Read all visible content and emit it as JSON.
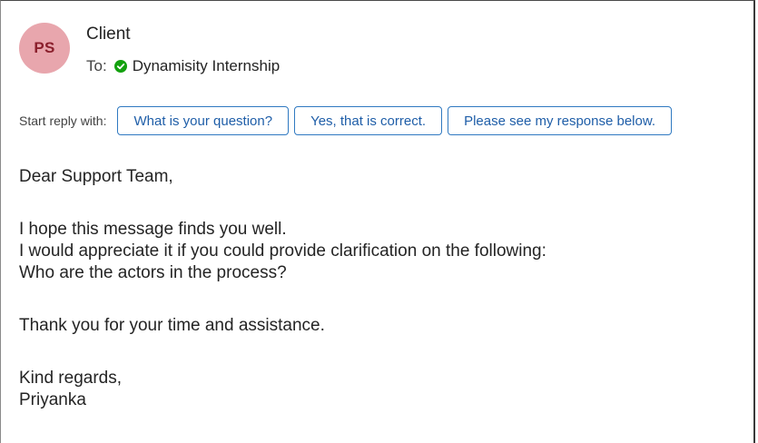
{
  "header": {
    "avatar_initials": "PS",
    "avatar_color": "#e8a6ad",
    "sender": "Client",
    "to_label": "To:",
    "recipient": "Dynamisity Internship",
    "recipient_status_icon": "check-circle-icon",
    "recipient_status_color": "#13a10e"
  },
  "reply_bar": {
    "label": "Start reply with:",
    "suggestions": [
      "What is your question?",
      "Yes, that is correct.",
      "Please see my response below."
    ]
  },
  "message": {
    "greeting": "Dear Support Team,",
    "line1": "I hope this message finds you well.",
    "line2": "I would appreciate it if you could provide clarification on the following:",
    "line3": "Who are the actors in the process?",
    "thanks": "Thank you for your time and assistance.",
    "closing": "Kind regards,",
    "signature": "Priyanka"
  }
}
